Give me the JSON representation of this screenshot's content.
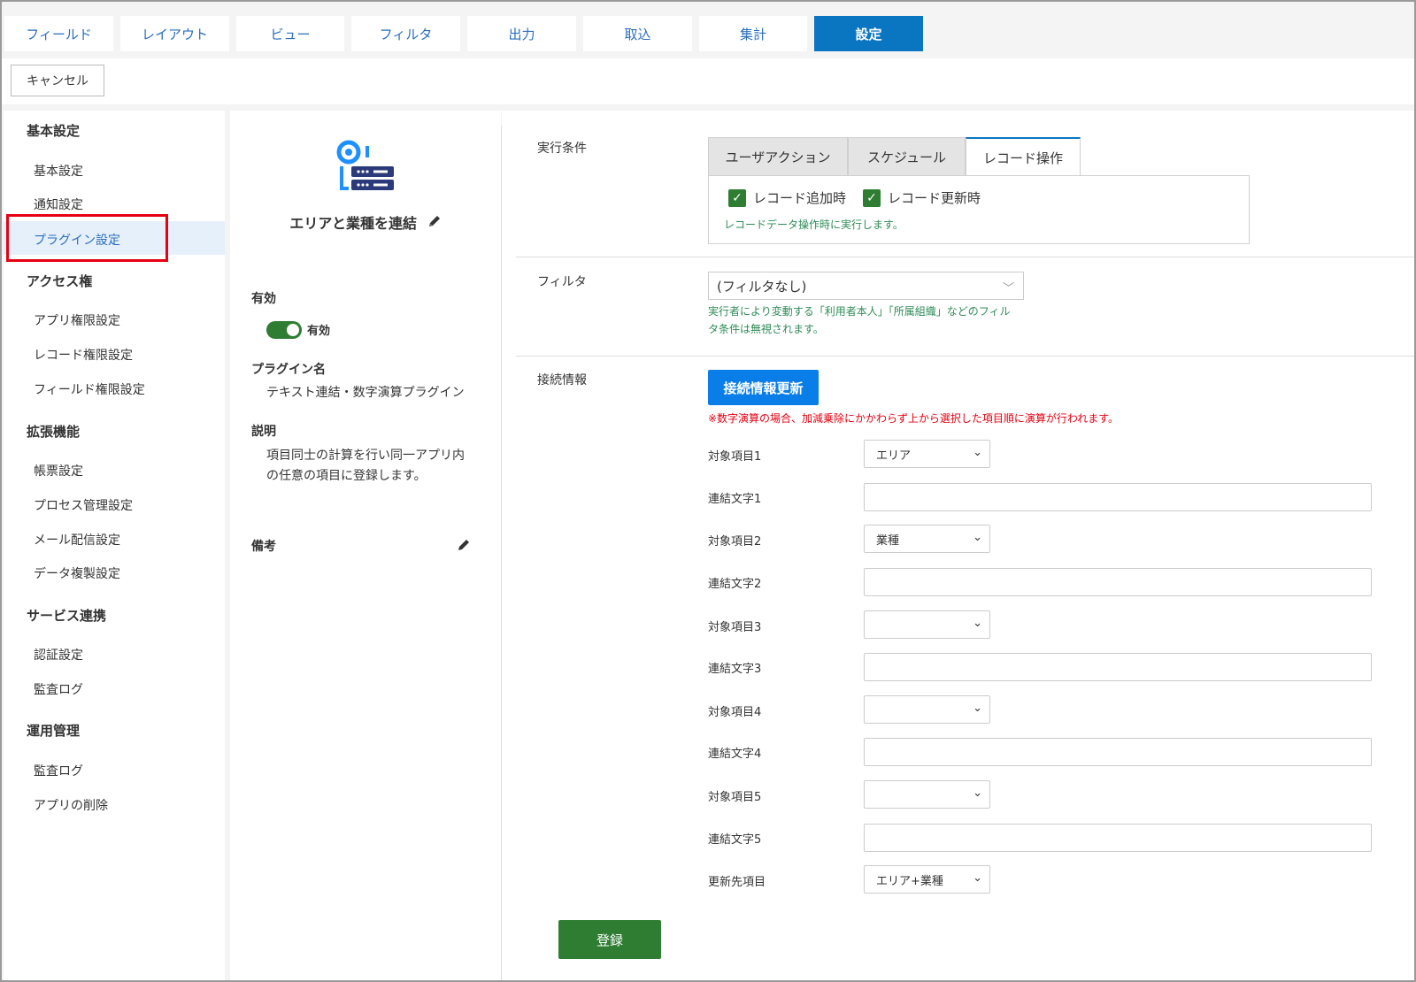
{
  "tabs": [
    "フィールド",
    "レイアウト",
    "ビュー",
    "フィルタ",
    "出力",
    "取込",
    "集計",
    "設定"
  ],
  "toolbar": {
    "cancel_label": "キャンセル"
  },
  "sidebar": {
    "groups": [
      {
        "heading": "基本設定",
        "items": [
          "基本設定",
          "通知設定",
          "プラグイン設定"
        ]
      },
      {
        "heading": "アクセス権",
        "items": [
          "アプリ権限設定",
          "レコード権限設定",
          "フィールド権限設定"
        ]
      },
      {
        "heading": "拡張機能",
        "items": [
          "帳票設定",
          "プロセス管理設定",
          "メール配信設定",
          "データ複製設定"
        ]
      },
      {
        "heading": "サービス連携",
        "items": [
          "認証設定",
          "監査ログ"
        ]
      },
      {
        "heading": "運用管理",
        "items": [
          "監査ログ",
          "アプリの削除"
        ]
      }
    ]
  },
  "plugin": {
    "title": "エリアと業種を連結",
    "enabled_label": "有効",
    "toggle_label": "有効",
    "name_label": "プラグイン名",
    "name": "テキスト連結・数字演算プラグイン",
    "desc_label": "説明",
    "desc_line1": "項目同士の計算を行い同一アプリ内",
    "desc_line2": "の任意の項目に登録します。",
    "note_label": "備考"
  },
  "condition": {
    "label": "実行条件",
    "tabs": [
      "ユーザアクション",
      "スケジュール",
      "レコード操作"
    ],
    "check1": "レコード追加時",
    "check2": "レコード更新時",
    "note": "レコードデータ操作時に実行します。"
  },
  "filter": {
    "label": "フィルタ",
    "value": "(フィルタなし)",
    "note_line1": "実行者により変動する「利用者本人」「所属組織」などのフィル",
    "note_line2": "タ条件は無視されます。"
  },
  "connection": {
    "label": "接続情報",
    "update_button": "接続情報更新",
    "warning": "※数字演算の場合、加減乗除にかかわらず上から選択した項目順に演算が行われます。",
    "fields": [
      {
        "label": "対象項目1",
        "value": "エリア"
      },
      {
        "label": "連結文字1"
      },
      {
        "label": "対象項目2",
        "value": "業種"
      },
      {
        "label": "連結文字2"
      },
      {
        "label": "対象項目3",
        "value": ""
      },
      {
        "label": "連結文字3"
      },
      {
        "label": "対象項目4",
        "value": ""
      },
      {
        "label": "連結文字4"
      },
      {
        "label": "対象項目5",
        "value": ""
      },
      {
        "label": "連結文字5"
      },
      {
        "label": "更新先項目",
        "value": "エリア+業種"
      }
    ]
  },
  "submit_label": "登録"
}
